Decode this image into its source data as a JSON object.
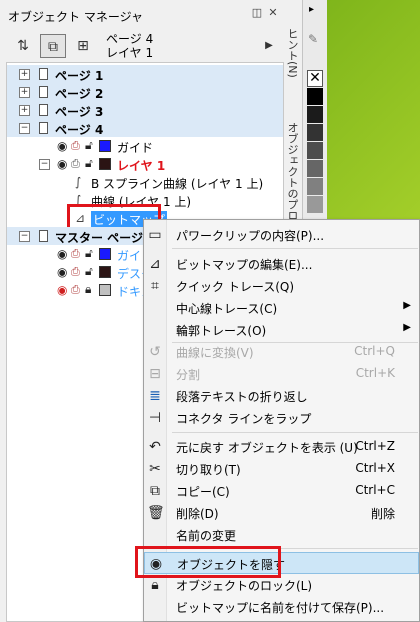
{
  "docker": {
    "title": "オブジェクト マネージャ",
    "page_info_line1": "ページ 4",
    "page_info_line2": "レイヤ 1",
    "toolbar_icons": [
      "show-object-properties-icon",
      "edit-across-layers-icon",
      "layer-manager-view-icon",
      "menu-arrow-icon"
    ]
  },
  "tree": {
    "pages": [
      "ページ 1",
      "ページ 2",
      "ページ 3",
      "ページ 4"
    ],
    "guide_layer": "ガイド",
    "layer1": "レイヤ 1",
    "objects": [
      "B スプライン曲線 (レイヤ 1 上)",
      "曲線 (レイヤ 1 上)",
      "ビットマップ"
    ],
    "master_page": "マスター ページ",
    "master_layers": [
      "ガイド",
      "デスクトップ",
      "ドキュメントグリッド"
    ]
  },
  "side_tabs": [
    "ヒント(N)",
    "オブジェクトのプロパティ"
  ],
  "colors": {
    "guide_swatch": "#1a1aff",
    "layer1_swatch": "#2b1414",
    "layer1_text": "#e0141b",
    "highlight_red": "#e0141b",
    "selection_blue": "#3399ff",
    "page_row_bg": "#dbe9f7"
  },
  "menu": {
    "items": [
      {
        "label": "パワークリップの内容(P)...",
        "shortcut": "",
        "icon": "powerclip-icon",
        "disabled": false,
        "submenu": false
      },
      {
        "label": "ビットマップの編集(E)...",
        "shortcut": "",
        "icon": "edit-bitmap-icon",
        "disabled": false,
        "submenu": false
      },
      {
        "label": "クイック トレース(Q)",
        "shortcut": "",
        "icon": "quick-trace-icon",
        "disabled": false,
        "submenu": false
      },
      {
        "label": "中心線トレース(C)",
        "shortcut": "",
        "icon": "",
        "disabled": false,
        "submenu": true
      },
      {
        "label": "輪郭トレース(O)",
        "shortcut": "",
        "icon": "",
        "disabled": false,
        "submenu": true
      },
      {
        "label": "曲線に変換(V)",
        "shortcut": "Ctrl+Q",
        "icon": "convert-to-curves-icon",
        "disabled": true,
        "submenu": false
      },
      {
        "label": "分割",
        "shortcut": "Ctrl+K",
        "icon": "break-apart-icon",
        "disabled": true,
        "submenu": false
      },
      {
        "label": "段落テキストの折り返し",
        "shortcut": "",
        "icon": "wrap-text-icon",
        "disabled": false,
        "submenu": false
      },
      {
        "label": "コネクタ ラインをラップ",
        "shortcut": "",
        "icon": "connector-icon",
        "disabled": false,
        "submenu": false
      },
      {
        "label": "元に戻す オブジェクトを表示 (U)",
        "shortcut": "Ctrl+Z",
        "icon": "undo-icon",
        "disabled": false,
        "submenu": false
      },
      {
        "label": "切り取り(T)",
        "shortcut": "Ctrl+X",
        "icon": "cut-icon",
        "disabled": false,
        "submenu": false
      },
      {
        "label": "コピー(C)",
        "shortcut": "Ctrl+C",
        "icon": "copy-icon",
        "disabled": false,
        "submenu": false
      },
      {
        "label": "削除(D)",
        "shortcut": "削除",
        "icon": "trash-icon",
        "disabled": false,
        "submenu": false
      },
      {
        "label": "名前の変更",
        "shortcut": "",
        "icon": "",
        "disabled": false,
        "submenu": false
      },
      {
        "label": "オブジェクトを隠す",
        "shortcut": "",
        "icon": "hide-object-icon",
        "disabled": false,
        "submenu": false
      },
      {
        "label": "オブジェクトのロック(L)",
        "shortcut": "",
        "icon": "lock-icon",
        "disabled": false,
        "submenu": false
      },
      {
        "label": "ビットマップに名前を付けて保存(P)...",
        "shortcut": "",
        "icon": "",
        "disabled": false,
        "submenu": false
      }
    ]
  }
}
